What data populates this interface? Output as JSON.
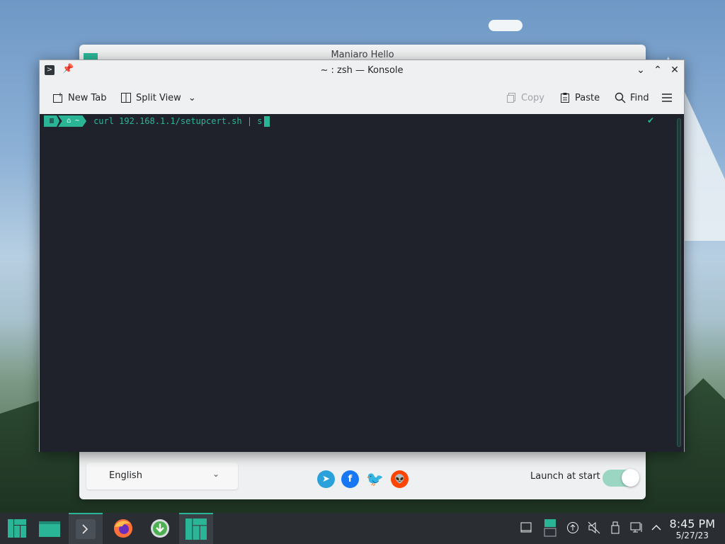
{
  "hello_window": {
    "title": "Maniaro Hello",
    "language_value": "English",
    "launch_label": "Launch at start",
    "launch_enabled": true,
    "social_icons": [
      "telegram-icon",
      "facebook-icon",
      "twitter-icon",
      "reddit-icon"
    ],
    "social_glyphs": [
      "➤",
      "f",
      "🐦",
      "👽"
    ],
    "social_colors": [
      "#2aa1da",
      "#1877f2",
      "#1da1f2",
      "#ff4500"
    ]
  },
  "konsole": {
    "title": "~ : zsh — Konsole",
    "toolbar": {
      "new_tab": "New Tab",
      "split_view": "Split View",
      "copy": "Copy",
      "paste": "Paste",
      "find": "Find"
    },
    "prompt": {
      "dir_glyph": "⌂ ~",
      "command": "curl 192.168.1.1/setupcert.sh | s"
    }
  },
  "taskbar": {
    "time": "8:45 PM",
    "date": "5/27/23"
  },
  "colors": {
    "accent": "#2bb597",
    "terminal_bg": "#1f222a",
    "taskbar_bg": "#2a2e32"
  }
}
